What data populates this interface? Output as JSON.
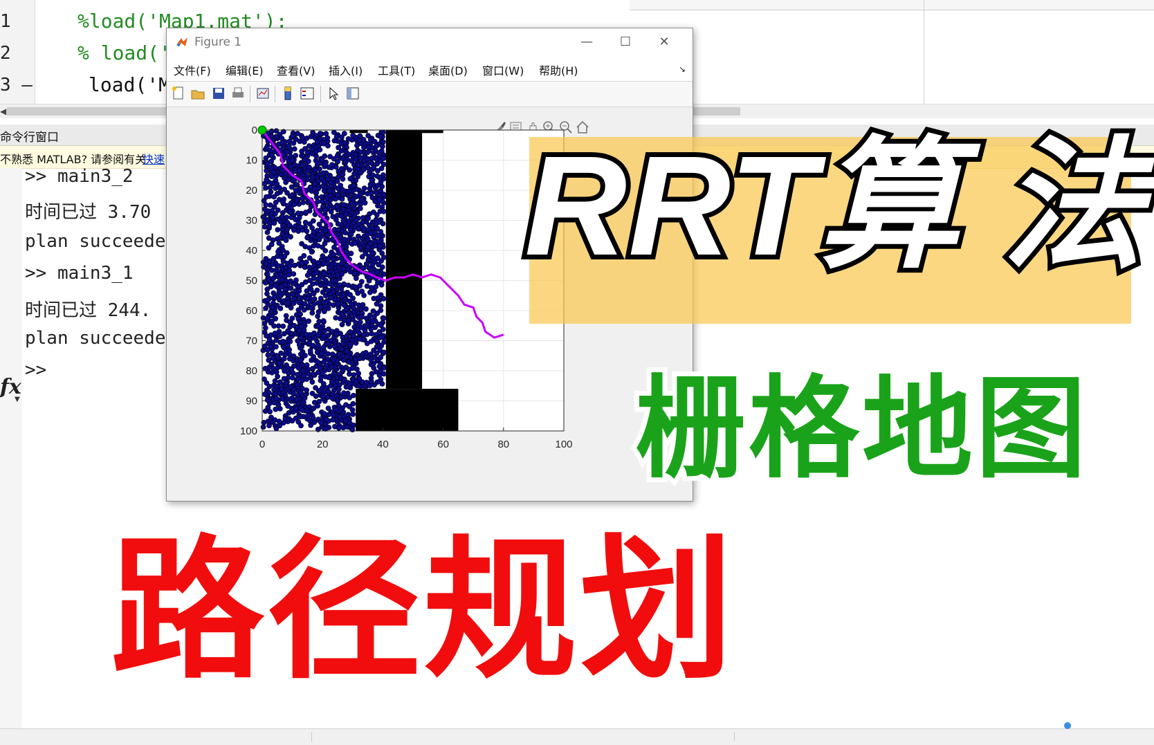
{
  "editor": {
    "lines": [
      {
        "num": "1",
        "text": "%load('Map1.mat');",
        "kind": "comment"
      },
      {
        "num": "2",
        "text": "% load('",
        "kind": "comment"
      },
      {
        "num": "3 —",
        "text": "load('M",
        "kind": "plain"
      }
    ]
  },
  "command_window": {
    "header": "命令行窗口",
    "notice_text": "不熟悉 MATLAB? 请参阅有关",
    "notice_link": "快速",
    "lines": [
      ">> main3_2",
      "时间已过 3.70",
      "plan succeede",
      ">> main3_1",
      "时间已过 244.",
      "plan succeede",
      ">>"
    ],
    "fx_label": "fx"
  },
  "figure": {
    "title": "Figure 1",
    "window_buttons": [
      "—",
      "☐",
      "✕"
    ],
    "menu": [
      "文件(F)",
      "编辑(E)",
      "查看(V)",
      "插入(I)",
      "工具(T)",
      "桌面(D)",
      "窗口(W)",
      "帮助(H)"
    ],
    "menu_overflow": "↘",
    "toolbar_icons": [
      "new-figure-icon",
      "open-file-icon",
      "save-icon",
      "print-icon",
      "link-plot-icon",
      "colorbar-icon",
      "legend-icon",
      "pointer-icon",
      "property-inspector-icon"
    ],
    "axes_toolbar_icons": [
      "brush-icon",
      "datatip-icon",
      "pan-icon",
      "zoom-in-icon",
      "zoom-out-icon",
      "home-icon"
    ]
  },
  "chart_data": {
    "type": "scatter",
    "title": "",
    "xlabel": "",
    "ylabel": "",
    "xlim": [
      0,
      100
    ],
    "ylim": [
      0,
      100
    ],
    "y_reversed": true,
    "x_ticks": [
      0,
      20,
      40,
      60,
      80,
      100
    ],
    "y_ticks": [
      0,
      10,
      20,
      30,
      40,
      50,
      60,
      70,
      80,
      90,
      100
    ],
    "grid": true,
    "node_color": "#0b0b8c",
    "path_color": "#c800ff",
    "obstacle_color": "#000000",
    "start": {
      "x": 0,
      "y": 0,
      "color": "#00cc00"
    },
    "obstacles": [
      {
        "x0": 29,
        "x1": 35,
        "y0": 0,
        "y1": 1
      },
      {
        "x0": 41,
        "x1": 53,
        "y0": 0,
        "y1": 86
      },
      {
        "x0": 31,
        "x1": 65,
        "y0": 86,
        "y1": 100
      },
      {
        "x0": 53,
        "x1": 60,
        "y0": 0,
        "y1": 1
      }
    ],
    "path": [
      [
        0,
        0
      ],
      [
        3,
        4
      ],
      [
        6,
        8
      ],
      [
        7,
        12
      ],
      [
        10,
        15
      ],
      [
        13,
        17
      ],
      [
        14,
        21
      ],
      [
        17,
        24
      ],
      [
        18,
        27
      ],
      [
        20,
        29
      ],
      [
        22,
        31
      ],
      [
        23,
        34
      ],
      [
        25,
        37
      ],
      [
        26,
        40
      ],
      [
        28,
        43
      ],
      [
        30,
        45
      ],
      [
        33,
        47
      ],
      [
        36,
        48
      ],
      [
        38,
        49
      ],
      [
        41,
        50
      ],
      [
        44,
        49
      ],
      [
        47,
        49
      ],
      [
        50,
        48
      ],
      [
        53,
        49
      ],
      [
        56,
        48
      ],
      [
        59,
        49
      ],
      [
        61,
        51
      ],
      [
        63,
        53
      ],
      [
        65,
        55
      ],
      [
        67,
        58
      ],
      [
        70,
        59
      ],
      [
        71,
        62
      ],
      [
        73,
        64
      ],
      [
        74,
        67
      ],
      [
        77,
        69
      ],
      [
        80,
        68
      ]
    ]
  },
  "overlay": {
    "title_main": "RRT算 法",
    "title_grid": "栅格地图",
    "title_path": "路径规划",
    "banner_color": "#f9c74f"
  }
}
